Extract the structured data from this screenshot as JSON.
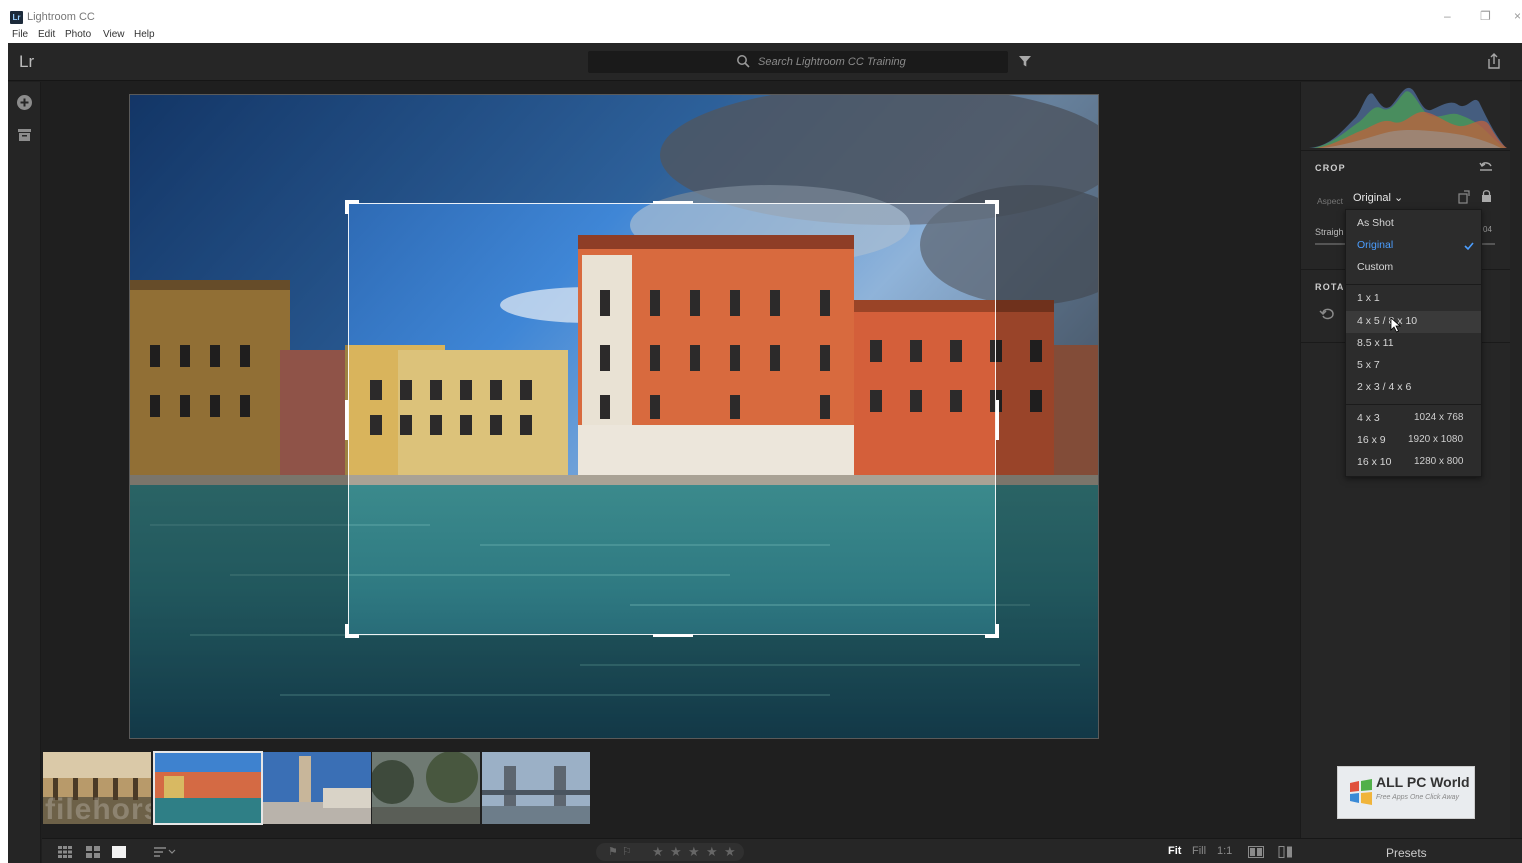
{
  "window": {
    "title": "Lightroom CC",
    "app_icon_text": "Lr",
    "minimize": "–",
    "restore": "❐",
    "close": "×"
  },
  "menu": [
    "File",
    "Edit",
    "Photo",
    "View",
    "Help"
  ],
  "topbar": {
    "logo": "Lr",
    "search_placeholder": "Search Lightroom CC Training"
  },
  "crop_panel": {
    "heading": "CROP",
    "aspect_label": "Aspect",
    "aspect_value": "Original",
    "straighten_label": "Straigh",
    "straighten_value": "04",
    "rotate_heading": "ROTA"
  },
  "aspect_dropdown": {
    "items": [
      {
        "label": "As Shot",
        "selected": false
      },
      {
        "label": "Original",
        "selected": true
      },
      {
        "label": "Custom",
        "selected": false
      },
      {
        "label": "1 x 1",
        "selected": false
      },
      {
        "label": "4 x 5 / 8 x 10",
        "selected": false
      },
      {
        "label": "8.5 x 11",
        "selected": false
      },
      {
        "label": "5 x 7",
        "selected": false
      },
      {
        "label": "2 x 3 / 4 x 6",
        "selected": false
      },
      {
        "label": "4 x 3",
        "resolution": "1024 x 768",
        "selected": false
      },
      {
        "label": "16 x 9",
        "resolution": "1920 x 1080",
        "selected": false
      },
      {
        "label": "16 x 10",
        "resolution": "1280 x 800",
        "selected": false
      }
    ]
  },
  "filmstrip": {
    "watermark": "filehorse",
    "thumbnails": 5,
    "selected_index": 1
  },
  "bottombar": {
    "stars": [
      "★",
      "★",
      "★",
      "★",
      "★"
    ],
    "zoom_options": [
      "Fit",
      "Fill",
      "1:1"
    ],
    "active_zoom": "Fit",
    "presets": "Presets"
  },
  "watermark_logo": {
    "title": "ALL PC World",
    "subtitle": "Free Apps One Click Away"
  },
  "colors": {
    "accent": "#4b9eff",
    "panel": "#262626",
    "canvas": "#1f1f1f"
  }
}
